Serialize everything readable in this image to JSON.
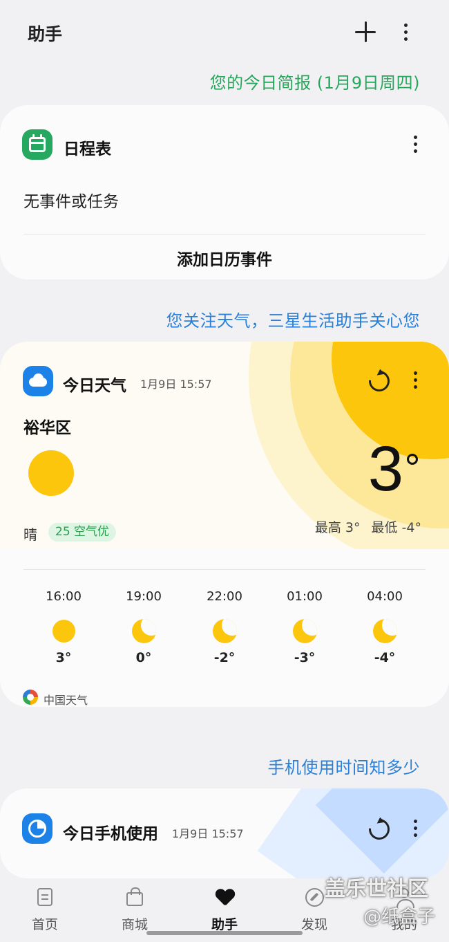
{
  "header": {
    "title": "助手",
    "add_icon": "plus-icon",
    "more_icon": "more-vertical-icon"
  },
  "briefing": "您的今日简报 (1月9日周四)",
  "schedule": {
    "icon": "calendar-icon",
    "title": "日程表",
    "empty_text": "无事件或任务",
    "add_label": "添加日历事件"
  },
  "weather_intro": "您关注天气，三星生活助手关心您",
  "weather": {
    "icon": "cloud-icon",
    "title": "今日天气",
    "updated": "1月9日 15:57",
    "location": "裕华区",
    "current_icon": "sun-icon",
    "temperature": "3",
    "condition": "晴",
    "aqi": "25 空气优",
    "high": "最高 3°",
    "low": "最低 -4°",
    "hourly": [
      {
        "time": "16:00",
        "icon": "sun-icon",
        "temp": "3°"
      },
      {
        "time": "19:00",
        "icon": "moon-icon",
        "temp": "0°"
      },
      {
        "time": "22:00",
        "icon": "moon-icon",
        "temp": "-2°"
      },
      {
        "time": "01:00",
        "icon": "moon-icon",
        "temp": "-3°"
      },
      {
        "time": "04:00",
        "icon": "moon-icon",
        "temp": "-4°"
      }
    ],
    "source": "中国天气",
    "colors": {
      "sun": "#fcc60d",
      "aqi_text": "#2a9d4e"
    }
  },
  "usage_intro": "手机使用时间知多少",
  "usage": {
    "icon": "pie-chart-icon",
    "title": "今日手机使用",
    "updated": "1月9日 15:57"
  },
  "nav": [
    {
      "label": "首页",
      "icon": "home-icon"
    },
    {
      "label": "商城",
      "icon": "shopping-bag-icon"
    },
    {
      "label": "助手",
      "icon": "heart-icon",
      "active": true
    },
    {
      "label": "发现",
      "icon": "compass-icon"
    },
    {
      "label": "我的",
      "icon": "user-icon"
    }
  ],
  "watermark": {
    "line1": "盖乐世社区",
    "line2": "@纸盒子"
  },
  "colors": {
    "green": "#26a65b",
    "blue": "#2a80d8",
    "background": "#f1f1f3"
  }
}
